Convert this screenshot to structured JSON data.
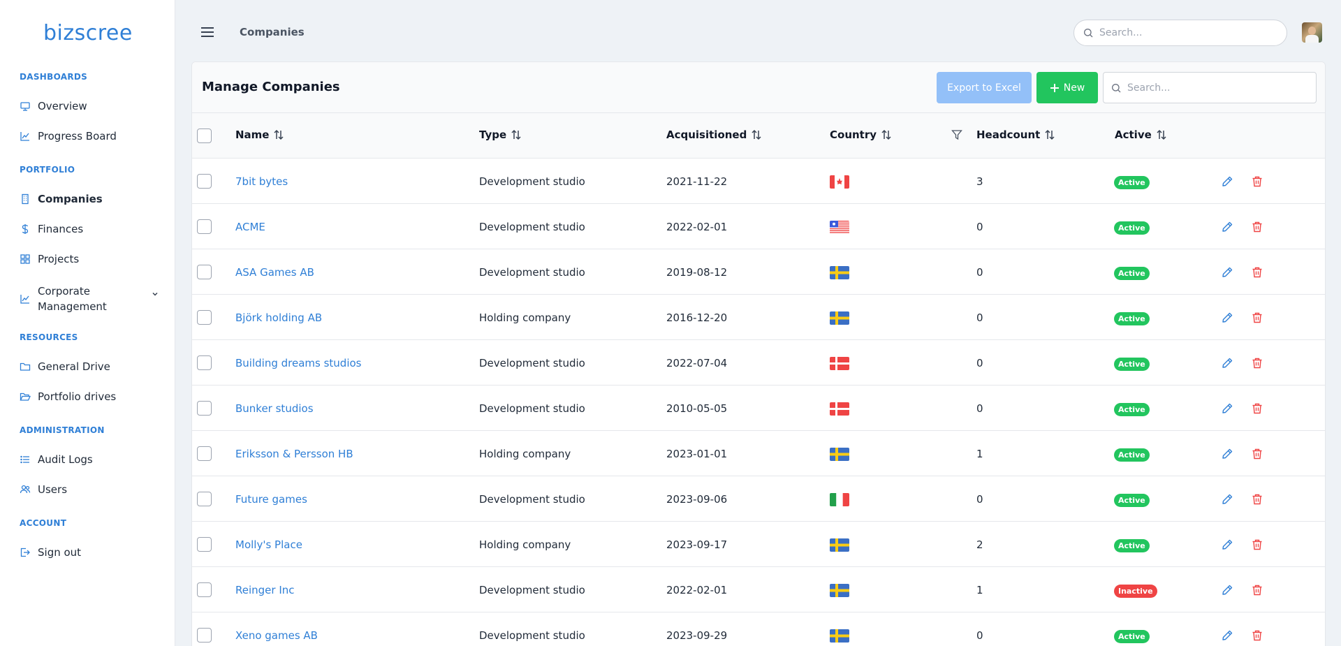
{
  "app": {
    "logo": "bizscree",
    "brand_color": "#2f7fd6",
    "page_title": "Companies",
    "search_placeholder": "Search..."
  },
  "sidebar": {
    "sections": [
      {
        "title": "DASHBOARDS",
        "items": [
          {
            "label": "Overview",
            "icon": "monitor-icon"
          },
          {
            "label": "Progress Board",
            "icon": "chart-line-icon"
          }
        ]
      },
      {
        "title": "PORTFOLIO",
        "items": [
          {
            "label": "Companies",
            "icon": "building-icon",
            "active": true
          },
          {
            "label": "Finances",
            "icon": "dollar-icon"
          },
          {
            "label": "Projects",
            "icon": "grid-icon"
          },
          {
            "label": "Corporate Management",
            "icon": "chart-line-icon",
            "expandable": true
          }
        ]
      },
      {
        "title": "RESOURCES",
        "items": [
          {
            "label": "General Drive",
            "icon": "folder-icon"
          },
          {
            "label": "Portfolio drives",
            "icon": "folder-open-icon"
          }
        ]
      },
      {
        "title": "ADMINISTRATION",
        "items": [
          {
            "label": "Audit Logs",
            "icon": "list-icon"
          },
          {
            "label": "Users",
            "icon": "users-icon"
          }
        ]
      },
      {
        "title": "ACCOUNT",
        "items": [
          {
            "label": "Sign out",
            "icon": "sign-out-icon"
          }
        ]
      }
    ]
  },
  "panel": {
    "title": "Manage Companies",
    "export_label": "Export to Excel",
    "new_label": "New",
    "search_placeholder": "Search..."
  },
  "table": {
    "columns": [
      "Name",
      "Type",
      "Acquisitioned",
      "Country",
      "Headcount",
      "Active"
    ],
    "rows": [
      {
        "name": "7bit bytes",
        "type": "Development studio",
        "date": "2021-11-22",
        "country": "canada",
        "headcount": "3",
        "status": "Active"
      },
      {
        "name": "ACME",
        "type": "Development studio",
        "date": "2022-02-01",
        "country": "usa",
        "headcount": "0",
        "status": "Active"
      },
      {
        "name": "ASA Games AB",
        "type": "Development studio",
        "date": "2019-08-12",
        "country": "sweden",
        "headcount": "0",
        "status": "Active"
      },
      {
        "name": "Björk holding AB",
        "type": "Holding company",
        "date": "2016-12-20",
        "country": "sweden",
        "headcount": "0",
        "status": "Active"
      },
      {
        "name": "Building dreams studios",
        "type": "Development studio",
        "date": "2022-07-04",
        "country": "denmark",
        "headcount": "0",
        "status": "Active"
      },
      {
        "name": "Bunker studios",
        "type": "Development studio",
        "date": "2010-05-05",
        "country": "denmark",
        "headcount": "0",
        "status": "Active"
      },
      {
        "name": "Eriksson & Persson HB",
        "type": "Holding company",
        "date": "2023-01-01",
        "country": "sweden",
        "headcount": "1",
        "status": "Active"
      },
      {
        "name": "Future games",
        "type": "Development studio",
        "date": "2023-09-06",
        "country": "italy",
        "headcount": "0",
        "status": "Active"
      },
      {
        "name": "Molly's Place",
        "type": "Holding company",
        "date": "2023-09-17",
        "country": "sweden",
        "headcount": "2",
        "status": "Active"
      },
      {
        "name": "Reinger Inc",
        "type": "Development studio",
        "date": "2022-02-01",
        "country": "sweden",
        "headcount": "1",
        "status": "Inactive"
      },
      {
        "name": "Xeno games AB",
        "type": "Development studio",
        "date": "2023-09-29",
        "country": "sweden",
        "headcount": "0",
        "status": "Active"
      }
    ]
  },
  "colors": {
    "active_badge": "#22c55e",
    "inactive_badge": "#ef4444",
    "new_button": "#22c55e",
    "export_button": "#93c0f8"
  }
}
